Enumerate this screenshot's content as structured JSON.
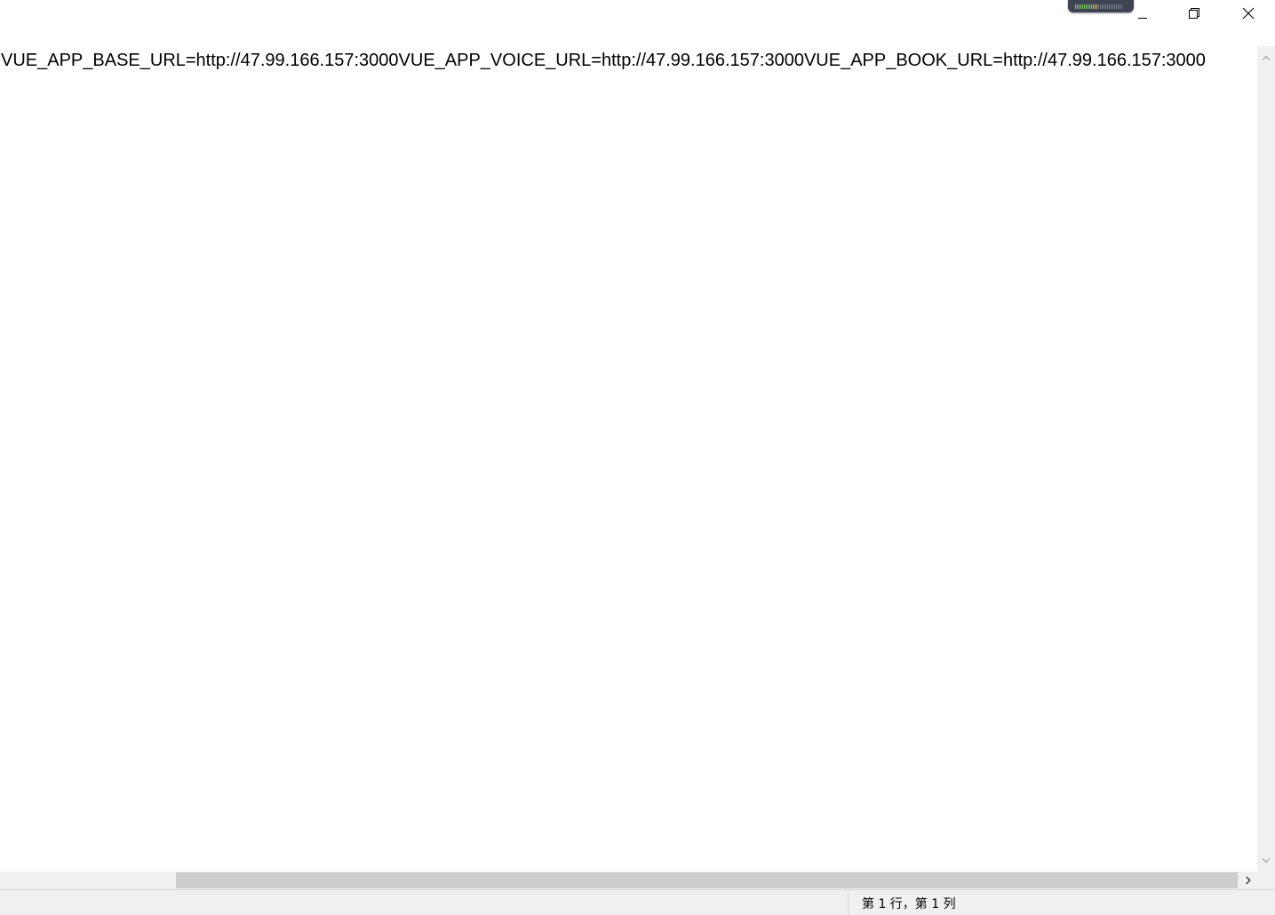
{
  "titlebar": {
    "minimize_icon": "minimize-icon",
    "maximize_icon": "restore-icon",
    "close_icon": "close-icon",
    "tray_widget_icon": "audio-level-meter-icon"
  },
  "editor": {
    "content": "VUE_APP_BASE_URL=http://47.99.166.157:3000VUE_APP_VOICE_URL=http://47.99.166.157:3000VUE_APP_BOOK_URL=http://47.99.166.157:3000"
  },
  "scrollbars": {
    "vertical_up_icon": "chevron-up-icon",
    "vertical_down_icon": "chevron-down-icon",
    "horizontal_right_icon": "chevron-right-icon"
  },
  "statusbar": {
    "position": "第 1 行，第 1 列"
  },
  "colors": {
    "background": "#ffffff",
    "chrome": "#f0f0f0",
    "scroll_thumb": "#cdcdcd",
    "text": "#000000"
  }
}
